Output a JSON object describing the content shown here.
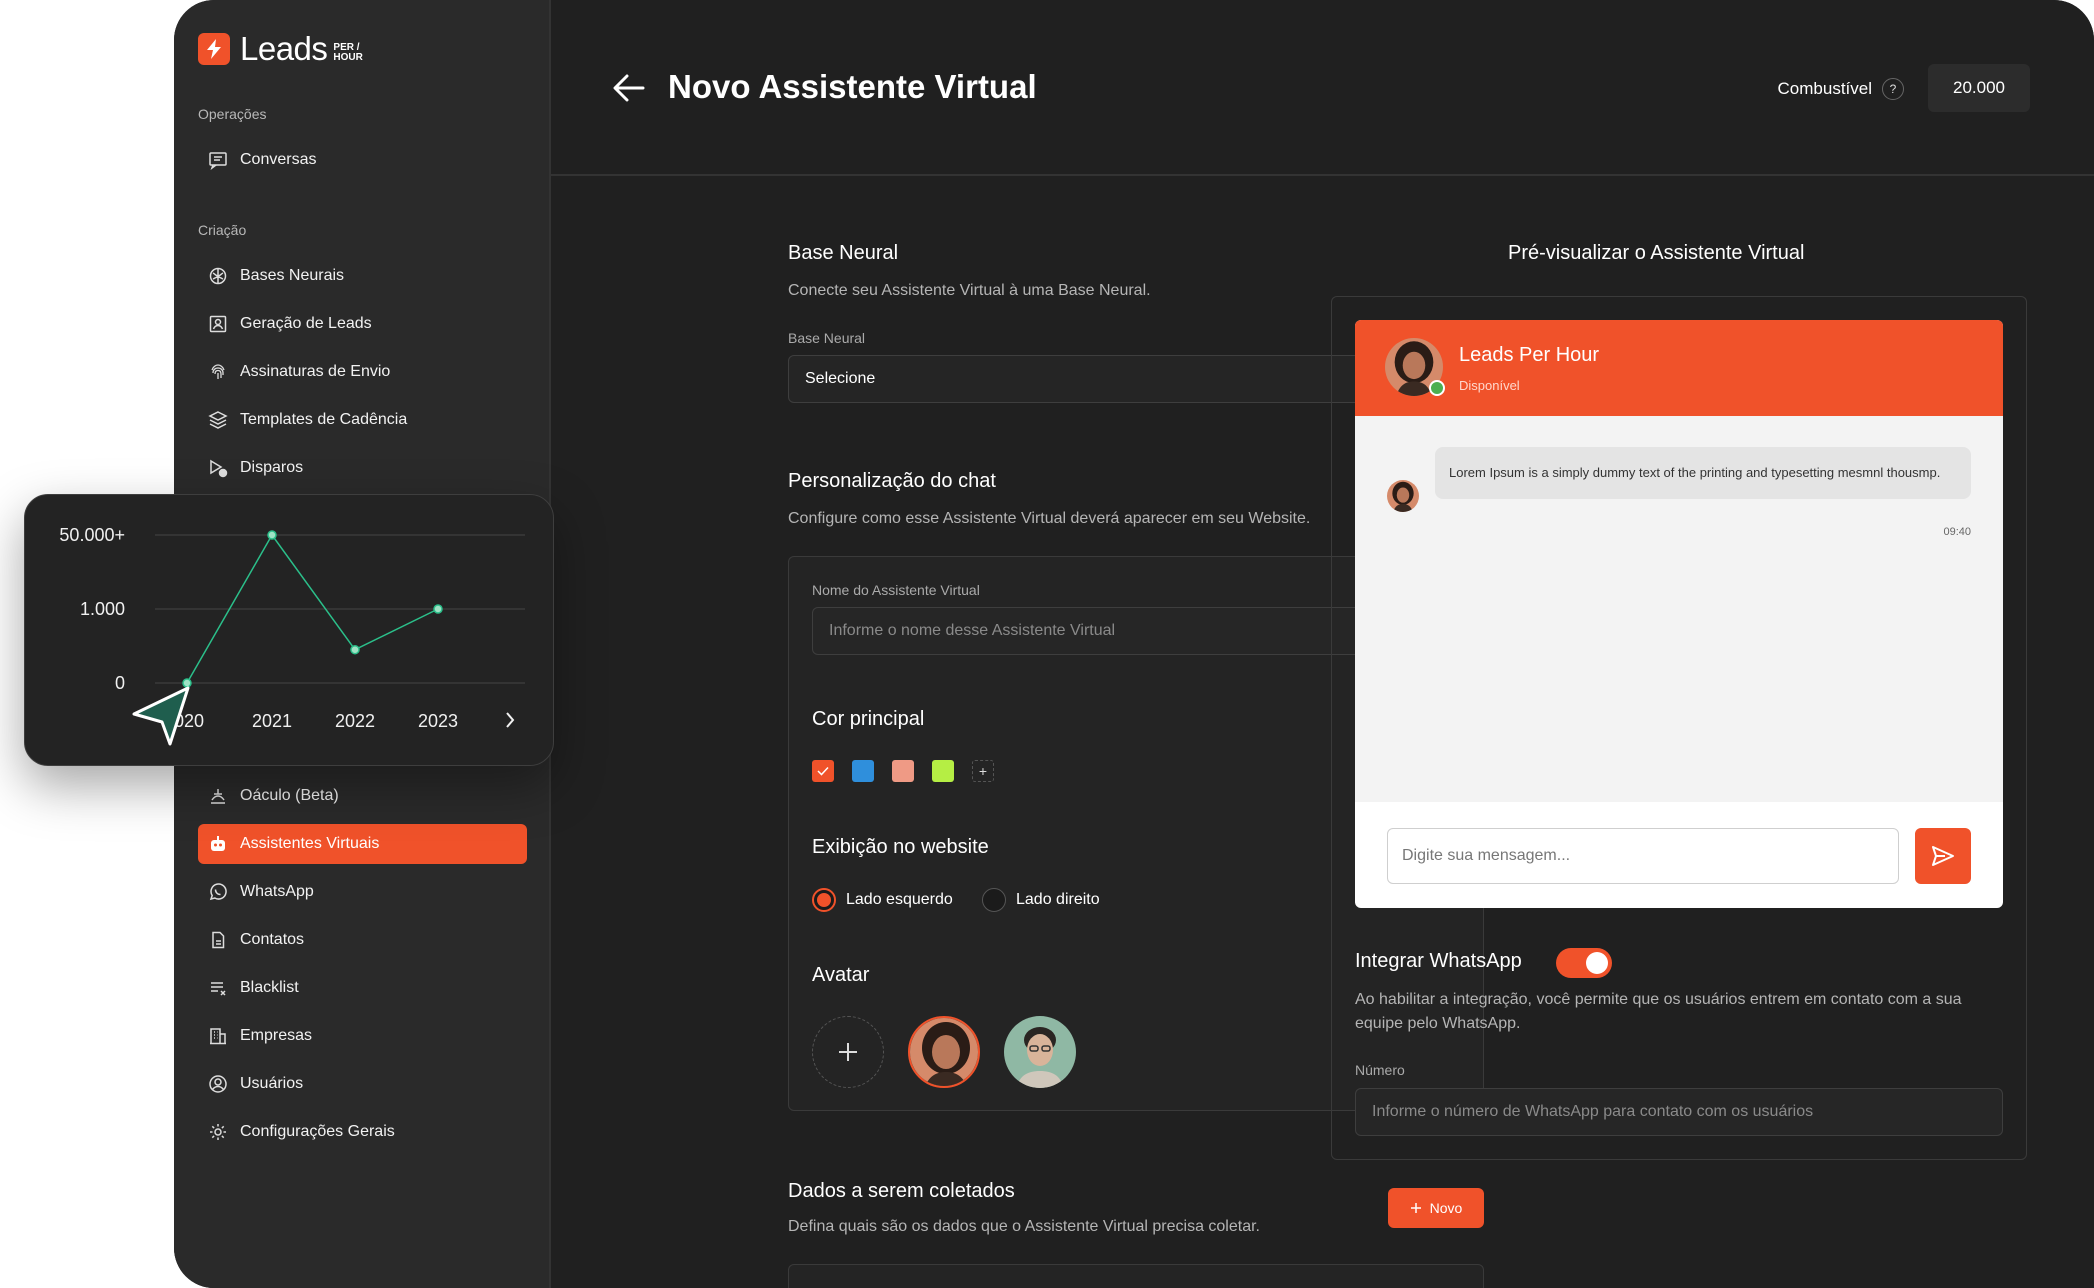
{
  "brand": {
    "name": "Leads",
    "sub_top": "PER /",
    "sub_bottom": "HOUR"
  },
  "sidebar": {
    "section_operacoes": "Operações",
    "section_criacao": "Criação",
    "items": [
      {
        "label": "Conversas",
        "icon": "chat-icon"
      },
      {
        "label": "Bases Neurais",
        "icon": "brain-icon"
      },
      {
        "label": "Geração de Leads",
        "icon": "contact-card-icon"
      },
      {
        "label": "Assinaturas de Envio",
        "icon": "fingerprint-icon"
      },
      {
        "label": "Templates de Cadência",
        "icon": "layers-icon"
      },
      {
        "label": "Disparos",
        "icon": "send-schedule-icon"
      },
      {
        "label": "Oáculo (Beta)",
        "icon": "oracle-icon"
      },
      {
        "label": "Assistentes Virtuais",
        "icon": "robot-icon",
        "active": true
      },
      {
        "label": "WhatsApp",
        "icon": "whatsapp-icon"
      },
      {
        "label": "Contatos",
        "icon": "document-icon"
      },
      {
        "label": "Blacklist",
        "icon": "list-x-icon"
      },
      {
        "label": "Empresas",
        "icon": "building-icon"
      },
      {
        "label": "Usuários",
        "icon": "user-circle-icon"
      },
      {
        "label": "Configurações Gerais",
        "icon": "gear-icon"
      }
    ]
  },
  "header": {
    "title": "Novo Assistente Virtual",
    "fuel_label": "Combustível",
    "fuel_help": "?",
    "fuel_value": "20.000"
  },
  "base_neural": {
    "title": "Base Neural",
    "description": "Conecte seu Assistente Virtual à uma Base Neural.",
    "field_label": "Base Neural",
    "select_value": "Selecione"
  },
  "chat_custom": {
    "title": "Personalização do chat",
    "description": "Configure como esse Assistente Virtual deverá aparecer em seu Website.",
    "name_label": "Nome do Assistente Virtual",
    "name_placeholder": "Informe o nome desse Assistente Virtual",
    "color_title": "Cor principal",
    "colors": [
      "#f0522a",
      "#2f8fdc",
      "#ef9a85",
      "#b5ee44"
    ],
    "selected_color": "#f0522a",
    "add_color": "+",
    "display_title": "Exibição no website",
    "display_options": [
      "Lado esquerdo",
      "Lado direito"
    ],
    "display_selected": "Lado esquerdo",
    "avatar_title": "Avatar"
  },
  "data_collect": {
    "title": "Dados a serem coletados",
    "description": "Defina quais são os dados que o Assistente Virtual precisa coletar.",
    "new_button": "Novo"
  },
  "preview": {
    "title": "Pré-visualizar o Assistente Virtual",
    "chat_name": "Leads Per Hour",
    "chat_status": "Disponível",
    "message": "Lorem Ipsum is a simply dummy text of the printing and typesetting mesmnl thousmp.",
    "message_time": "09:40",
    "input_placeholder": "Digite sua mensagem..."
  },
  "whatsapp": {
    "title": "Integrar WhatsApp",
    "enabled": true,
    "description": "Ao habilitar a integração, você permite que os usuários entrem em contato com a sua equipe pelo WhatsApp.",
    "number_label": "Número",
    "number_placeholder": "Informe o número de WhatsApp para contato com os usuários"
  },
  "chart_data": {
    "type": "line",
    "x": [
      "2020",
      "2021",
      "2022",
      "2023"
    ],
    "x_labels_visible": [
      "020",
      "2021",
      "2022",
      "2023"
    ],
    "y_tick_labels": [
      "0",
      "1.000",
      "50.000+"
    ],
    "values": [
      0,
      50000,
      450,
      1000
    ],
    "line_color": "#2bbf8a",
    "grid": true
  }
}
